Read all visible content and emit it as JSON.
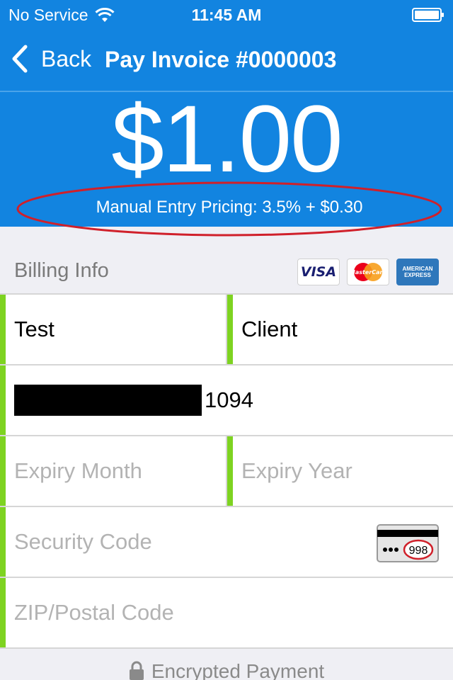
{
  "status_bar": {
    "carrier": "No Service",
    "time": "11:45 AM",
    "wifi_icon": "wifi-icon",
    "battery_icon": "battery-icon"
  },
  "nav": {
    "back_label": "Back",
    "title": "Pay Invoice #0000003"
  },
  "amount": "$1.00",
  "pricing_note": "Manual Entry Pricing: 3.5% + $0.30",
  "colors": {
    "header_bg": "#1284e0",
    "valid_indicator": "#7ed321",
    "annotation_ellipse": "#d0202a"
  },
  "billing": {
    "label": "Billing Info",
    "cards": [
      "VISA",
      "MasterCard",
      "AMERICAN EXPRESS"
    ]
  },
  "form": {
    "first_name": "Test",
    "last_name": "Client",
    "card_number_last4": "1094",
    "expiry_month_placeholder": "Expiry Month",
    "expiry_year_placeholder": "Expiry Year",
    "security_code_placeholder": "Security Code",
    "cvv_hint": "998",
    "zip_placeholder": "ZIP/Postal Code"
  },
  "footer": {
    "text": "Encrypted Payment"
  }
}
